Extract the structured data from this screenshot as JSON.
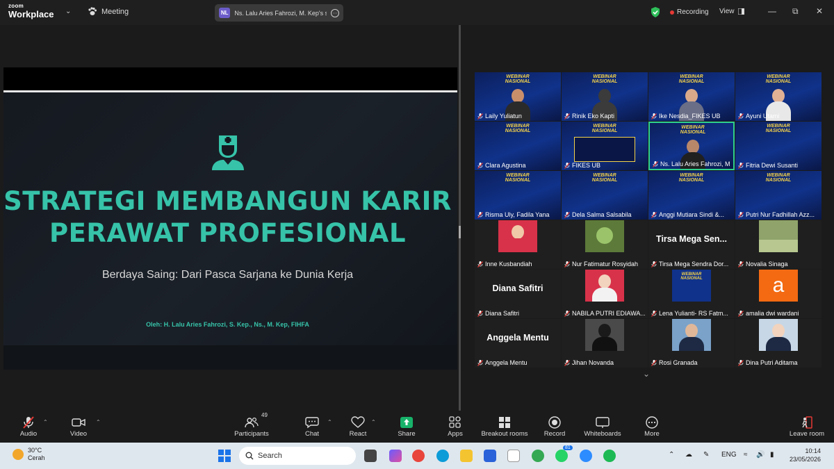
{
  "titlebar": {
    "logo_line1": "zoom",
    "logo_line2": "Workplace",
    "meeting_label": "Meeting",
    "share_badge": "NL",
    "share_text": "Ns. Lalu Aries Fahrozi, M. Kep's sc",
    "recording_label": "Recording",
    "view_label": "View"
  },
  "slide": {
    "title_line1": "STRATEGI MEMBANGUN KARIR",
    "title_line2": "PERAWAT PROFESIONAL",
    "subtitle": "Berdaya Saing: Dari Pasca Sarjana ke Dunia Kerja",
    "author": "Oleh: H. Lalu Aries Fahrozi, S. Kep., Ns., M. Kep, FIHFA"
  },
  "gallery": {
    "banner_text": "WEBINAR NASIONAL",
    "participants": [
      {
        "name": "Laily Yuliatun",
        "type": "video",
        "skin": "#c98f6b",
        "body": "#2a2a2a"
      },
      {
        "name": "Rinik Eko Kapti",
        "type": "video",
        "skin": "#3b3b3b",
        "body": "#3b3b3b"
      },
      {
        "name": "Ike Nesdia_FIKES UB",
        "type": "video",
        "skin": "#d9a98a",
        "body": "#6a6e86"
      },
      {
        "name": "Ayuni Utami",
        "type": "video",
        "skin": "#e0b194",
        "body": "#e8e8e8"
      },
      {
        "name": "Clara Agustina",
        "type": "video",
        "skin": "",
        "body": ""
      },
      {
        "name": "FIKES UB",
        "type": "video-share",
        "skin": "",
        "body": ""
      },
      {
        "name": "Ns. Lalu Aries Fahrozi, M...",
        "type": "video-active",
        "skin": "#b8876a",
        "body": "#202020"
      },
      {
        "name": "Fitria Dewi Susanti",
        "type": "video",
        "skin": "",
        "body": ""
      },
      {
        "name": "Risma Uly, Fadila Yana",
        "type": "video",
        "skin": "",
        "body": ""
      },
      {
        "name": "Dela Salma Salsabila",
        "type": "video",
        "skin": "",
        "body": ""
      },
      {
        "name": "Anggi Mutiara Sindi &...",
        "type": "video",
        "skin": "",
        "body": ""
      },
      {
        "name": "Putri Nur Fadhillah Azz...",
        "type": "video",
        "skin": "",
        "body": ""
      },
      {
        "name": "Inne Kusbandiah",
        "type": "avatar",
        "avatar_color": "#d8324a",
        "skin": "#f0c9a8",
        "body": "#d8324a"
      },
      {
        "name": "Nur Fatimatur Rosyidah",
        "type": "avatar-leaf",
        "avatar_color": "#5d7a3a",
        "skin": "",
        "body": ""
      },
      {
        "name": "Tirsa Mega Sendra Dor...",
        "type": "name",
        "big_name": "Tirsa Mega Sen..."
      },
      {
        "name": "Novalia Sinaga",
        "type": "avatar-scene",
        "avatar_color": "#8fa36a",
        "skin": "",
        "body": ""
      },
      {
        "name": "Diana Safitri",
        "type": "name",
        "big_name": "Diana Safitri"
      },
      {
        "name": "NABILA PUTRI EDIAWA...",
        "type": "avatar",
        "avatar_color": "#d8324a",
        "skin": "#f2d3bd",
        "body": "#f2f2f2"
      },
      {
        "name": "Lena Yulianti- RS Fatm...",
        "type": "avatar-banner",
        "avatar_color": "#10328a",
        "skin": "",
        "body": ""
      },
      {
        "name": "amalia dwi wardani",
        "type": "letter",
        "avatar_color": "#f36a12",
        "letter": "a"
      },
      {
        "name": "Anggela Mentu",
        "type": "name",
        "big_name": "Anggela Mentu"
      },
      {
        "name": "Jihan Novanda",
        "type": "avatar",
        "avatar_color": "#4a4a4a",
        "skin": "#1a1a1a",
        "body": "#111"
      },
      {
        "name": "Rosi Granada",
        "type": "avatar",
        "avatar_color": "#7ba2c9",
        "skin": "#e0b899",
        "body": "#1e2a44"
      },
      {
        "name": "Dina Putri Aditama",
        "type": "avatar",
        "avatar_color": "#c7d7e6",
        "skin": "#f2d3bd",
        "body": "#1e2a44"
      }
    ]
  },
  "toolbar": {
    "audio": "Audio",
    "video": "Video",
    "participants": "Participants",
    "participants_count": "49",
    "chat": "Chat",
    "react": "React",
    "share": "Share",
    "apps": "Apps",
    "breakout": "Breakout rooms",
    "record": "Record",
    "whiteboards": "Whiteboards",
    "more": "More",
    "leave": "Leave room"
  },
  "taskbar": {
    "temp": "30°C",
    "weather": "Cerah",
    "search": "Search",
    "lang": "ENG",
    "time": "10:14",
    "date": "23/05/2026",
    "whatsapp_badge": "81"
  },
  "colors": {
    "accent_teal": "#36c3a9",
    "active_speaker": "#2fd08e",
    "share_green": "#17b26a",
    "leave_red": "#e53935"
  }
}
